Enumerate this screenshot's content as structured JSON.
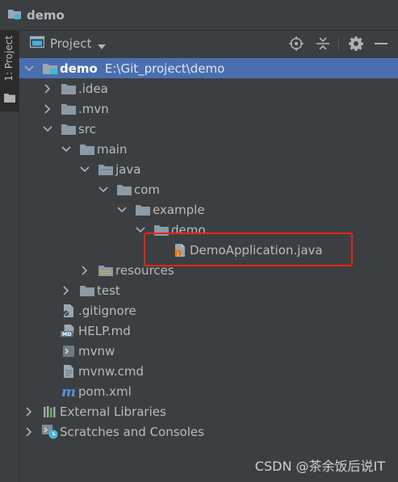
{
  "window": {
    "title": "demo"
  },
  "side_tab": {
    "label": "1: Project"
  },
  "toolbar": {
    "view_label": "Project"
  },
  "tree": [
    {
      "label": "demo",
      "path": "E:\\Git_project\\demo",
      "depth": 0,
      "arrow": "down",
      "icon": "module-folder-icon",
      "selected": true,
      "bold": true
    },
    {
      "label": ".idea",
      "depth": 1,
      "arrow": "right",
      "icon": "folder-icon"
    },
    {
      "label": ".mvn",
      "depth": 1,
      "arrow": "right",
      "icon": "folder-icon"
    },
    {
      "label": "src",
      "depth": 1,
      "arrow": "down",
      "icon": "folder-icon"
    },
    {
      "label": "main",
      "depth": 2,
      "arrow": "down",
      "icon": "folder-icon"
    },
    {
      "label": "java",
      "depth": 3,
      "arrow": "down",
      "icon": "source-folder-icon"
    },
    {
      "label": "com",
      "depth": 4,
      "arrow": "down",
      "icon": "package-icon"
    },
    {
      "label": "example",
      "depth": 5,
      "arrow": "down",
      "icon": "package-icon"
    },
    {
      "label": "demo",
      "depth": 6,
      "arrow": "down",
      "icon": "package-icon"
    },
    {
      "label": "DemoApplication.java",
      "depth": 7,
      "arrow": "none",
      "icon": "java-class-icon"
    },
    {
      "label": "resources",
      "depth": 3,
      "arrow": "right",
      "icon": "resources-folder-icon"
    },
    {
      "label": "test",
      "depth": 2,
      "arrow": "right",
      "icon": "folder-icon"
    },
    {
      "label": ".gitignore",
      "depth": 1,
      "arrow": "none",
      "icon": "gitignore-file-icon"
    },
    {
      "label": "HELP.md",
      "depth": 1,
      "arrow": "none",
      "icon": "markdown-file-icon"
    },
    {
      "label": "mvnw",
      "depth": 1,
      "arrow": "none",
      "icon": "shell-script-icon"
    },
    {
      "label": "mvnw.cmd",
      "depth": 1,
      "arrow": "none",
      "icon": "text-file-icon"
    },
    {
      "label": "pom.xml",
      "depth": 1,
      "arrow": "none",
      "icon": "maven-file-icon"
    },
    {
      "label": "External Libraries",
      "depth": 0,
      "arrow": "right",
      "icon": "libraries-icon"
    },
    {
      "label": "Scratches and Consoles",
      "depth": 0,
      "arrow": "right",
      "icon": "scratches-icon"
    }
  ],
  "watermark": "CSDN @茶余饭后说IT",
  "colors": {
    "selection": "#4b6eaf",
    "highlight_box": "#e8231a",
    "background": "#3c3f41"
  }
}
